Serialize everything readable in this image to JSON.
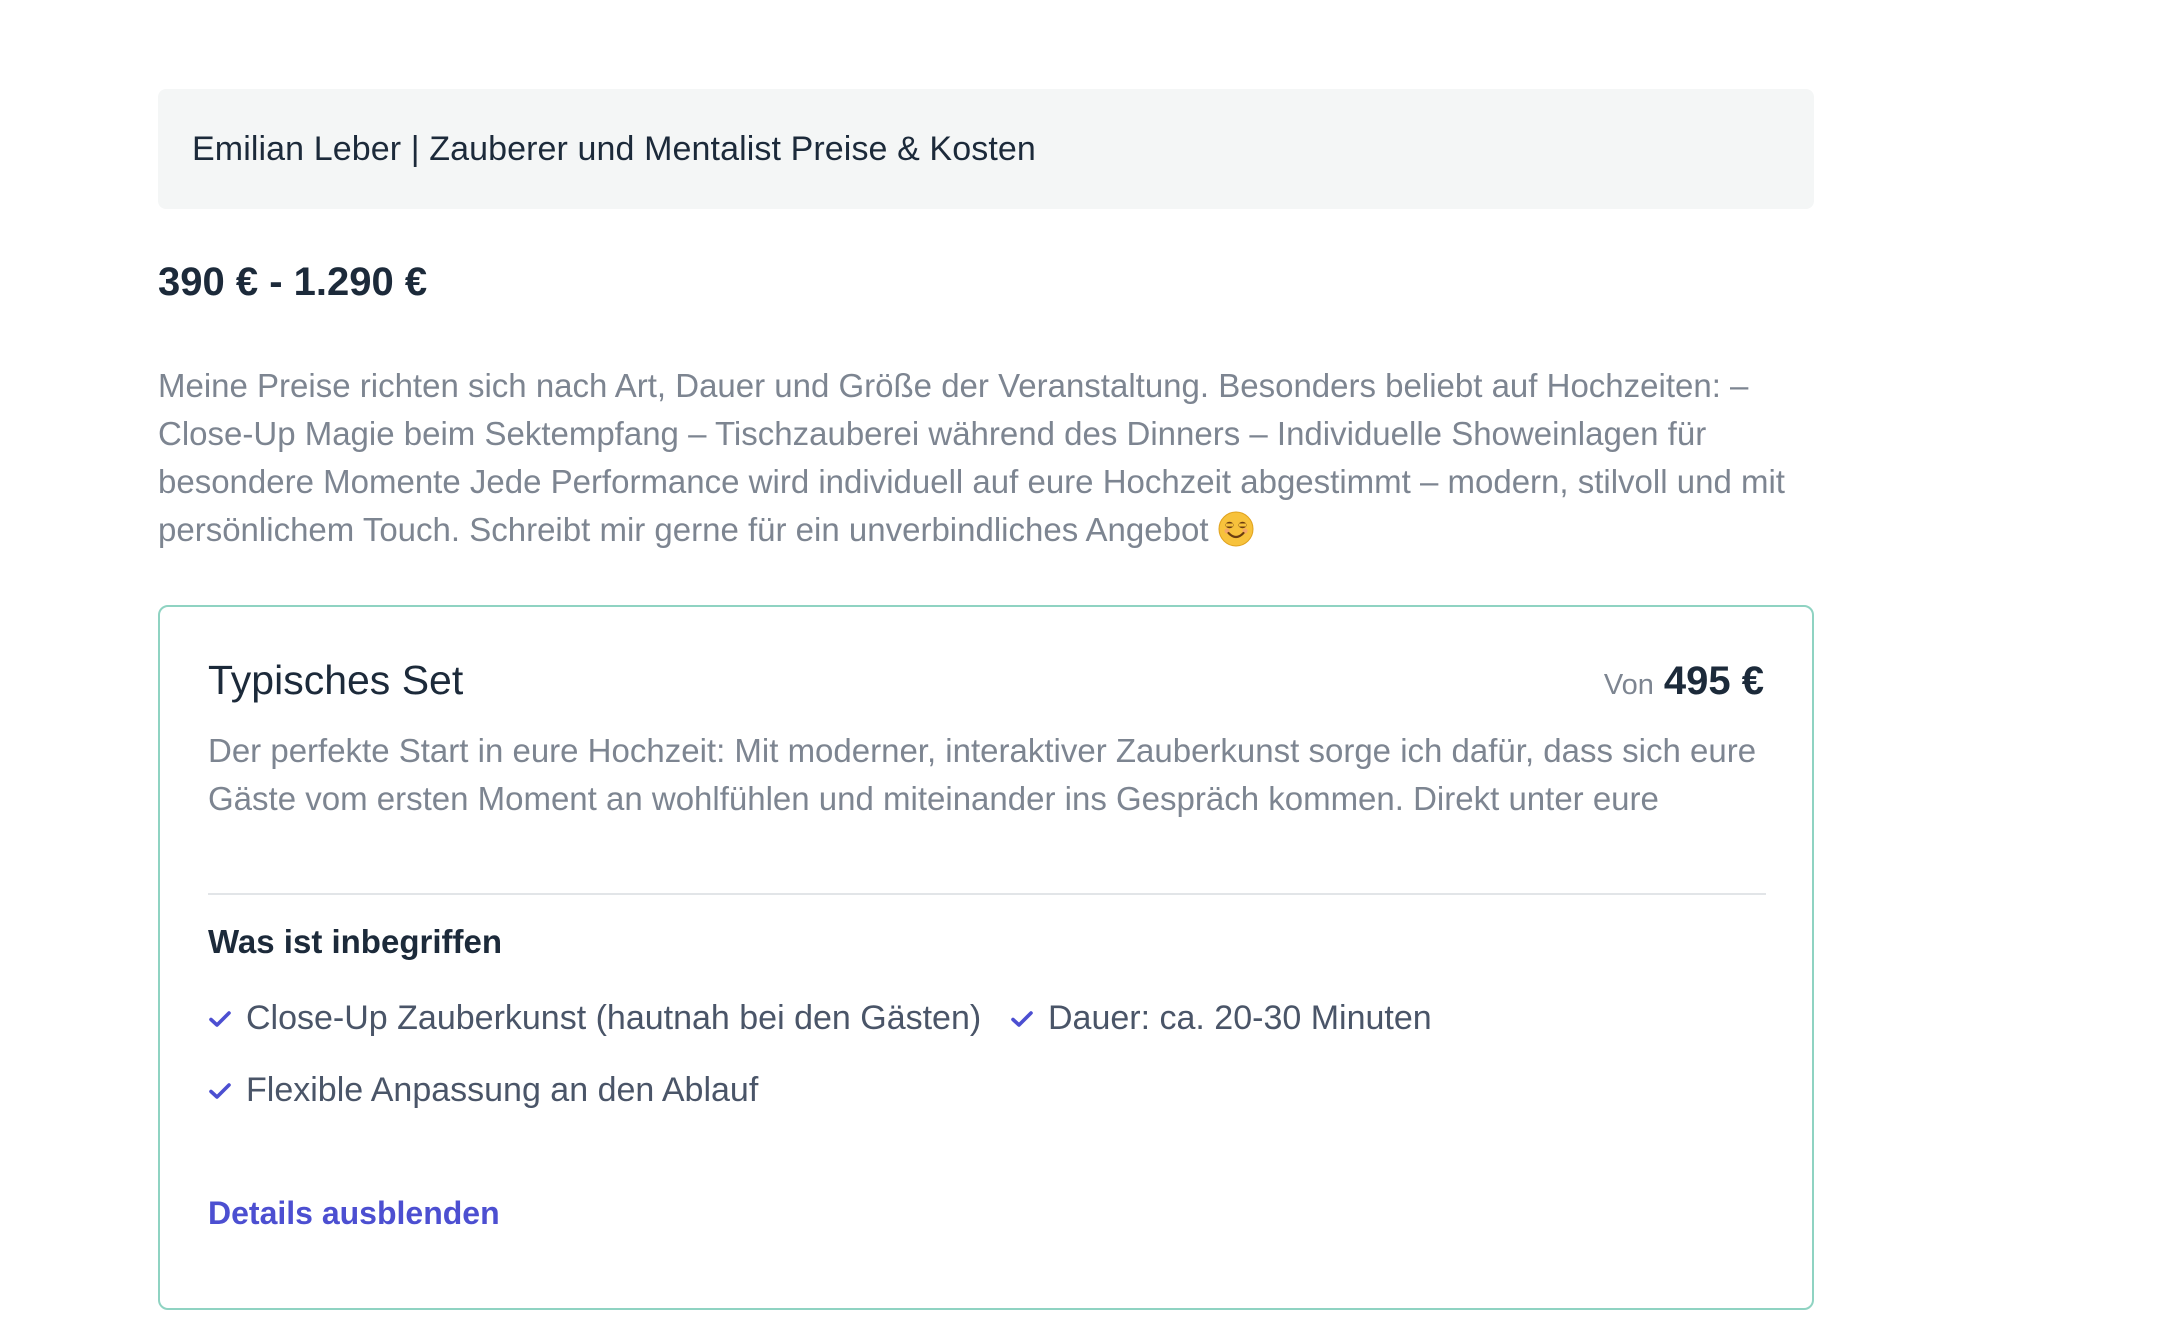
{
  "header": {
    "title": "Emilian Leber | Zauberer und Mentalist Preise & Kosten"
  },
  "price_range": "390 € - 1.290 €",
  "description": "Meine Preise richten sich nach Art, Dauer und Größe der Veranstaltung. Besonders beliebt auf Hochzeiten: – Close-Up Magie beim Sektempfang – Tischzauberei während des Dinners – Individuelle Showeinlagen für besondere Momente Jede Performance wird individuell auf eure Hochzeit abgestimmt – modern, stilvoll und mit persönlichem Touch. Schreibt mir gerne für ein unverbindliches Angebot",
  "description_emoji": "smiling-face-emoji",
  "package": {
    "title": "Typisches Set",
    "price_prefix": "Von",
    "price_value": "495 €",
    "description": "Der perfekte Start in eure Hochzeit: Mit moderner, interaktiver Zauberkunst sorge ich dafür, dass sich eure Gäste vom ersten Moment an wohlfühlen und miteinander ins Gespräch kommen. Direkt unter eure",
    "included_heading": "Was ist inbegriffen",
    "features": [
      "Close-Up Zauberkunst (hautnah bei den Gästen)",
      "Dauer: ca. 20-30 Minuten",
      "Flexible Anpassung an den Ablauf"
    ],
    "details_toggle_label": "Details ausblenden"
  },
  "colors": {
    "accent": "#4c4fd1",
    "card_border": "#8fd3c2",
    "header_bg": "#f4f6f6",
    "muted_text": "#7d8591",
    "heading_text": "#1c2a3a"
  }
}
